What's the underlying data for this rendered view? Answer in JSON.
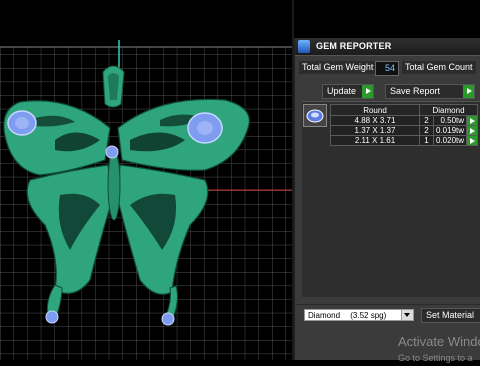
{
  "panel": {
    "title": "GEM REPORTER",
    "total_weight_label": "Total Gem Weight",
    "total_weight_value": "54",
    "total_count_label": "Total Gem Count",
    "update_label": "Update",
    "save_report_label": "Save Report",
    "table": {
      "headers": [
        "Round",
        "Diamond"
      ],
      "rows": [
        {
          "size": "4.88 X 3.71",
          "count": "2",
          "weight": "0.50tw"
        },
        {
          "size": "1.37 X 1.37",
          "count": "2",
          "weight": "0.019tw"
        },
        {
          "size": "2.11 X 1.61",
          "count": "1",
          "weight": "0.020tw"
        }
      ]
    },
    "material_name": "Diamond",
    "material_spg": "(3.52 spg)",
    "set_material_label": "Set Material"
  },
  "viewport": {
    "model_color": "#2ea57c",
    "gem_color": "#7e9cf0"
  },
  "watermark": {
    "line1": "Activate Windo",
    "line2": "Go to Settings to a"
  }
}
